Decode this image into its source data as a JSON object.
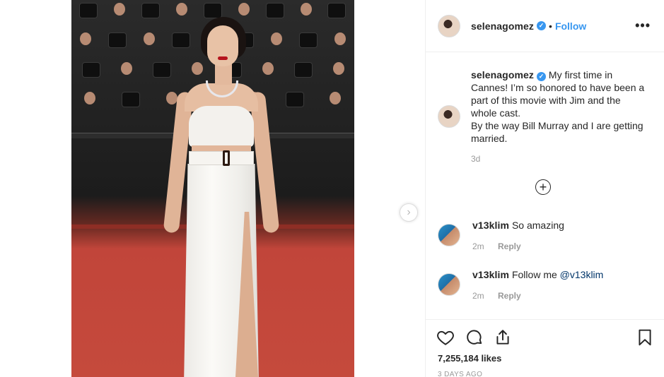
{
  "post": {
    "author": "selenagomez",
    "follow_label": "Follow",
    "separator": "•",
    "more_label": "•••",
    "caption_text": "My first time in Cannes! I’m so honored to have been a part of this movie with Jim and the whole cast.",
    "caption_text_2": "By the way Bill Murray and I are getting married.",
    "caption_time": "3d",
    "load_more_label": "+",
    "next_label": "›"
  },
  "comments": [
    {
      "user": "v13klim",
      "text": "So amazing",
      "time": "2m",
      "reply_label": "Reply"
    },
    {
      "user": "v13klim",
      "text": "Follow me ",
      "mention": "@v13klim",
      "time": "2m",
      "reply_label": "Reply"
    }
  ],
  "footer": {
    "likes": "7,255,184 likes",
    "posted": "3 DAYS AGO"
  },
  "icons": {
    "verified": "verified-badge-icon",
    "like": "heart-icon",
    "comment": "comment-bubble-icon",
    "share": "share-icon",
    "save": "bookmark-icon"
  },
  "colors": {
    "link": "#3897f0",
    "text": "#262626",
    "muted": "#999999",
    "divider": "#efefef"
  }
}
